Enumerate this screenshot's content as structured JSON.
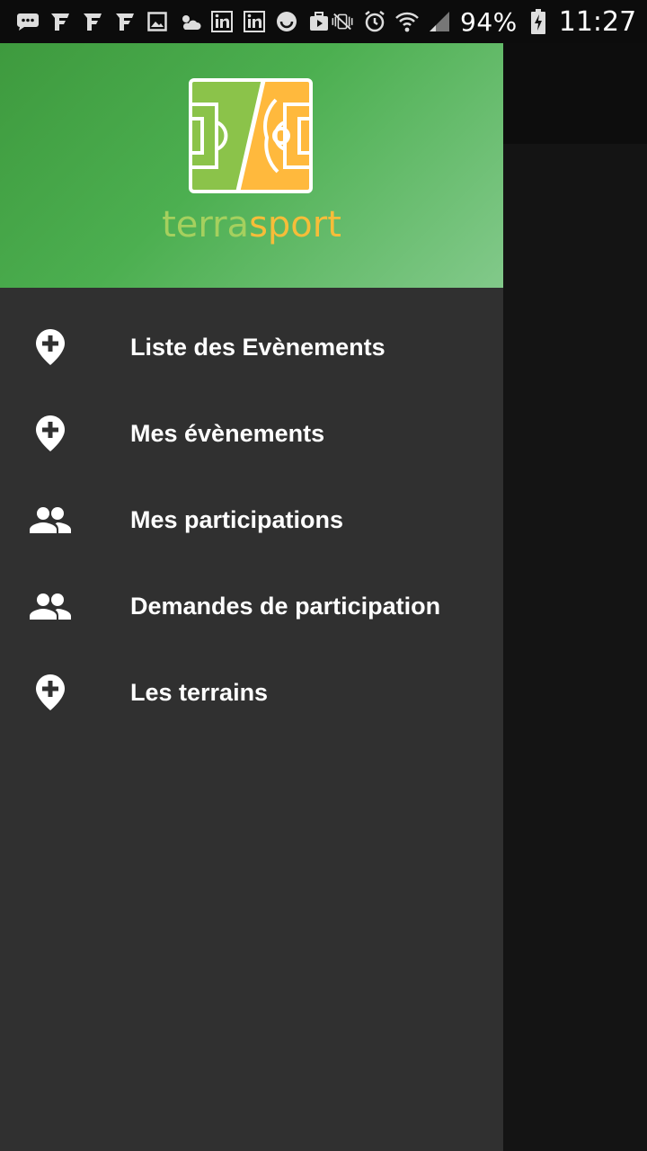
{
  "status_bar": {
    "battery_percent": "94%",
    "time": "11:27",
    "notification_icons": [
      "chat-icon",
      "f-icon",
      "f-icon",
      "f-icon",
      "image-icon",
      "weather-icon",
      "linkedin-icon",
      "linkedin-icon",
      "smile-icon",
      "play-store-icon"
    ],
    "system_icons": [
      "vibrate-mute-icon",
      "alarm-icon",
      "wifi-icon",
      "signal-icon",
      "battery-charging-icon"
    ]
  },
  "drawer": {
    "brand": {
      "part1": "terra",
      "part2": "sport"
    },
    "items": [
      {
        "label": "Liste des Evènements",
        "icon": "add-location-icon"
      },
      {
        "label": "Mes évènements",
        "icon": "add-location-icon"
      },
      {
        "label": "Mes participations",
        "icon": "people-icon"
      },
      {
        "label": "Demandes de participation",
        "icon": "people-icon"
      },
      {
        "label": "Les terrains",
        "icon": "add-location-icon"
      }
    ]
  },
  "colors": {
    "header_green": "#4caf50",
    "drawer_bg": "#303030",
    "logo_green": "#8bc34a",
    "logo_yellow": "#ffb93d"
  }
}
